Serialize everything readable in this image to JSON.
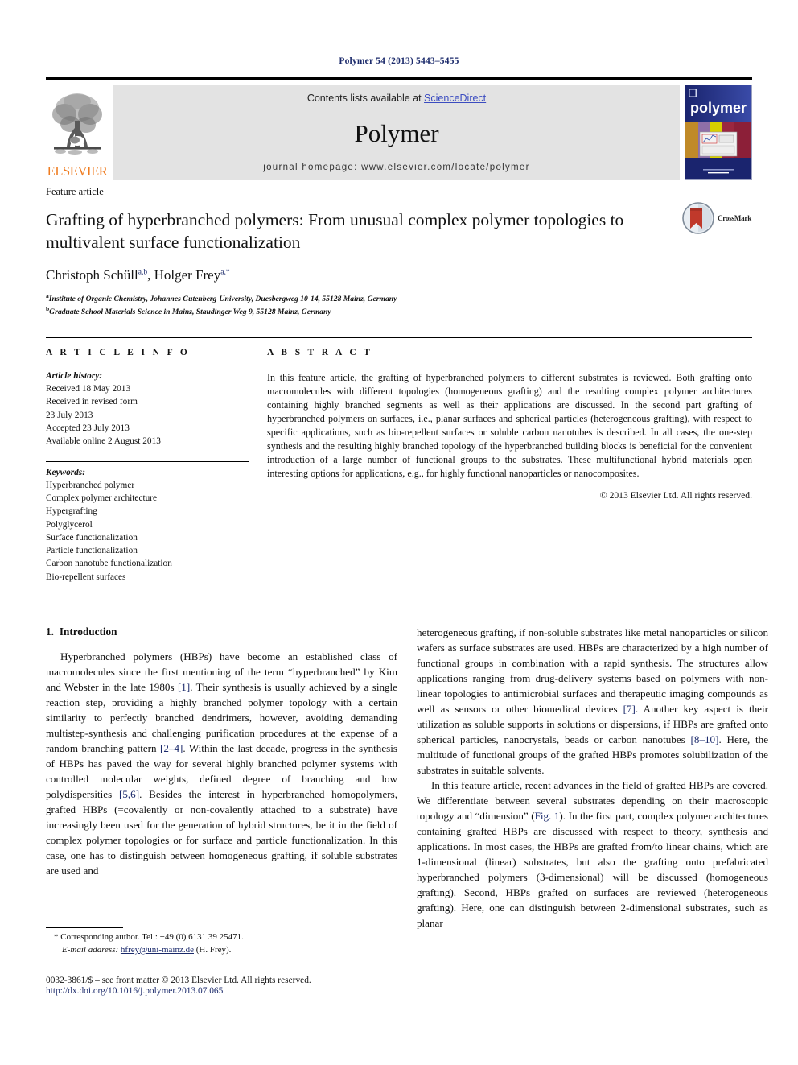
{
  "running_head": "Polymer 54 (2013) 5443–5455",
  "masthead": {
    "elsevier_wordmark": "ELSEVIER",
    "contents_prefix": "Contents lists available at ",
    "contents_link": "ScienceDirect",
    "journal_name": "Polymer",
    "homepage": "journal homepage: www.elsevier.com/locate/polymer",
    "cover_title": "polymer"
  },
  "article": {
    "type_label": "Feature article",
    "title": "Grafting of hyperbranched polymers: From unusual complex polymer topologies to multivalent surface functionalization",
    "authors_plain": "Christoph Schüll a,b, Holger Frey a,*",
    "author1": "Christoph Schüll",
    "author1_sup": "a,b",
    "author2": "Holger Frey",
    "author2_sup": "a,*",
    "affiliations": [
      {
        "marker": "a",
        "text": "Institute of Organic Chemistry, Johannes Gutenberg-University, Duesbergweg 10-14, 55128 Mainz, Germany"
      },
      {
        "marker": "b",
        "text": "Graduate School Materials Science in Mainz, Staudinger Weg 9, 55128 Mainz, Germany"
      }
    ],
    "crossmark_label": "CrossMark"
  },
  "article_info": {
    "heading": "A R T I C L E  I N F O",
    "history_label": "Article history:",
    "history": [
      "Received 18 May 2013",
      "Received in revised form",
      "23 July 2013",
      "Accepted 23 July 2013",
      "Available online 2 August 2013"
    ],
    "keywords_label": "Keywords:",
    "keywords": [
      "Hyperbranched polymer",
      "Complex polymer architecture",
      "Hypergrafting",
      "Polyglycerol",
      "Surface functionalization",
      "Particle functionalization",
      "Carbon nanotube functionalization",
      "Bio-repellent surfaces"
    ]
  },
  "abstract": {
    "heading": "A B S T R A C T",
    "text": "In this feature article, the grafting of hyperbranched polymers to different substrates is reviewed. Both grafting onto macromolecules with different topologies (homogeneous grafting) and the resulting complex polymer architectures containing highly branched segments as well as their applications are discussed. In the second part grafting of hyperbranched polymers on surfaces, i.e., planar surfaces and spherical particles (heterogeneous grafting), with respect to specific applications, such as bio-repellent surfaces or soluble carbon nanotubes is described. In all cases, the one-step synthesis and the resulting highly branched topology of the hyperbranched building blocks is beneficial for the convenient introduction of a large number of functional groups to the substrates. These multifunctional hybrid materials open interesting options for applications, e.g., for highly functional nanoparticles or nanocomposites.",
    "copyright": "© 2013 Elsevier Ltd. All rights reserved."
  },
  "body": {
    "section_number": "1.",
    "section_title": "Introduction",
    "left_paragraph_1_a": "Hyperbranched polymers (HBPs) have become an established class of macromolecules since the first mentioning of the term “hyperbranched” by Kim and Webster in the late 1980s ",
    "left_ref_1": "[1]",
    "left_paragraph_1_b": ". Their synthesis is usually achieved by a single reaction step, providing a highly branched polymer topology with a certain similarity to perfectly branched dendrimers, however, avoiding demanding multistep-synthesis and challenging purification procedures at the expense of a random branching pattern ",
    "left_ref_2": "[2–4]",
    "left_paragraph_1_c": ". Within the last decade, progress in the synthesis of HBPs has paved the way for several highly branched polymer systems with controlled molecular weights, defined degree of branching and low polydispersities ",
    "left_ref_3": "[5,6]",
    "left_paragraph_1_d": ". Besides the interest in hyperbranched homopolymers, grafted HBPs (=covalently or non-covalently attached to a substrate) have increasingly been used for the generation of hybrid structures, be it in the field of complex polymer topologies or for surface and particle functionalization. In this case, one has to distinguish between homogeneous grafting, if soluble substrates are used and",
    "right_paragraph_1_a": "heterogeneous grafting, if non-soluble substrates like metal nanoparticles or silicon wafers as surface substrates are used. HBPs are characterized by a high number of functional groups in combination with a rapid synthesis. The structures allow applications ranging from drug-delivery systems based on polymers with non-linear topologies to antimicrobial surfaces and therapeutic imaging compounds as well as sensors or other biomedical devices ",
    "right_ref_1": "[7]",
    "right_paragraph_1_b": ". Another key aspect is their utilization as soluble supports in solutions or dispersions, if HBPs are grafted onto spherical particles, nanocrystals, beads or carbon nanotubes ",
    "right_ref_2": "[8–10]",
    "right_paragraph_1_c": ". Here, the multitude of functional groups of the grafted HBPs promotes solubilization of the substrates in suitable solvents.",
    "right_paragraph_2_a": "In this feature article, recent advances in the field of grafted HBPs are covered. We differentiate between several substrates depending on their macroscopic topology and “dimension” (",
    "right_ref_3": "Fig. 1",
    "right_paragraph_2_b": "). In the first part, complex polymer architectures containing grafted HBPs are discussed with respect to theory, synthesis and applications. In most cases, the HBPs are grafted from/to linear chains, which are 1-dimensional (linear) substrates, but also the grafting onto prefabricated hyperbranched polymers (3-dimensional) will be discussed (homogeneous grafting). Second, HBPs grafted on surfaces are reviewed (heterogeneous grafting). Here, one can distinguish between 2-dimensional substrates, such as planar"
  },
  "footnote": {
    "corresponding": "* Corresponding author. Tel.: +49 (0) 6131 39 25471.",
    "email_label": "E-mail address:",
    "email": "hfrey@uni-mainz.de",
    "email_suffix": " (H. Frey)."
  },
  "footer": {
    "line1": "0032-3861/$ – see front matter © 2013 Elsevier Ltd. All rights reserved.",
    "line2": "http://dx.doi.org/10.1016/j.polymer.2013.07.065"
  },
  "colors": {
    "link_blue": "#1b2a6b",
    "sciencedirect_blue": "#3b4cc0",
    "elsevier_orange": "#ef7c20",
    "masthead_gray": "#e3e3e3",
    "cover_navy": "#1d2a77",
    "crossmark_red": "#c0392b"
  }
}
